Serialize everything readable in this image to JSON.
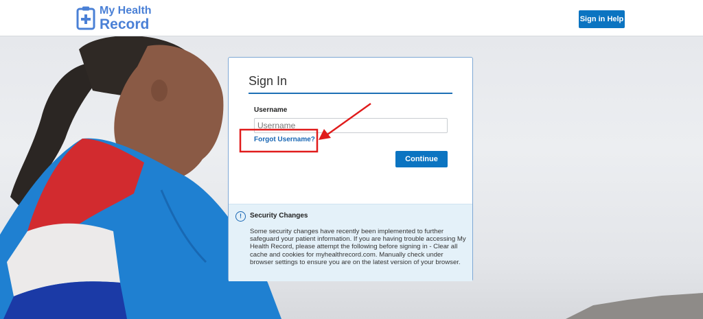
{
  "header": {
    "logo_line1": "My Health",
    "logo_line2": "Record",
    "help_button": "Sign in Help"
  },
  "signin": {
    "title": "Sign In",
    "username_label": "Username",
    "username_placeholder": "Username",
    "username_value": "",
    "forgot_link": "Forgot Username?",
    "continue_button": "Continue"
  },
  "security": {
    "title": "Security Changes",
    "body": "Some security changes have recently been implemented to further safeguard your patient information. If you are having trouble accessing My Health Record, please attempt the following before signing in - Clear all cache and cookies for myhealthrecord.com. Manually check under browser settings to ensure you are on the latest version of your browser."
  },
  "colors": {
    "brand_blue": "#4a80d6",
    "button_blue": "#0b74c1",
    "annotation_red": "#e01b1b"
  },
  "icons": {
    "logo": "clipboard-plus-icon",
    "security": "info-circle-icon"
  }
}
